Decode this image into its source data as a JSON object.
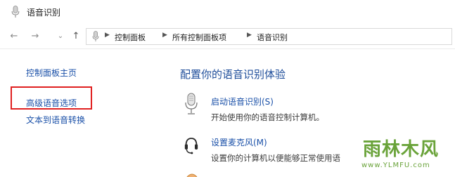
{
  "window": {
    "title": "语音识别",
    "icon": "microphone-icon"
  },
  "nav": {
    "back_icon": "back-arrow-icon",
    "forward_icon": "forward-arrow-icon",
    "recent_icon": "chevron-down-icon",
    "up_icon": "up-arrow-icon"
  },
  "address": {
    "icon": "microphone-icon",
    "crumbs": [
      "控制面板",
      "所有控制面板项",
      "语音识别"
    ]
  },
  "sidebar": {
    "items": [
      {
        "label": "控制面板主页"
      },
      {
        "label": "高级语音选项"
      },
      {
        "label": "文本到语音转换"
      }
    ],
    "highlight_color": "#e02020"
  },
  "main": {
    "heading": "配置你的语音识别体验",
    "tasks": [
      {
        "icon": "microphone-icon",
        "title": "启动语音识别(S)",
        "desc": "开始使用你的语音控制计算机。"
      },
      {
        "icon": "headset-icon",
        "title": "设置麦克风(M)",
        "desc": "设置你的计算机以便能够正常使用语"
      }
    ]
  },
  "watermark": {
    "text": "雨林木风",
    "url": "www.YLMFU.com"
  },
  "colors": {
    "link": "#1a50a8",
    "heading": "#1e4d9a",
    "watermark": "#6aa33a"
  }
}
